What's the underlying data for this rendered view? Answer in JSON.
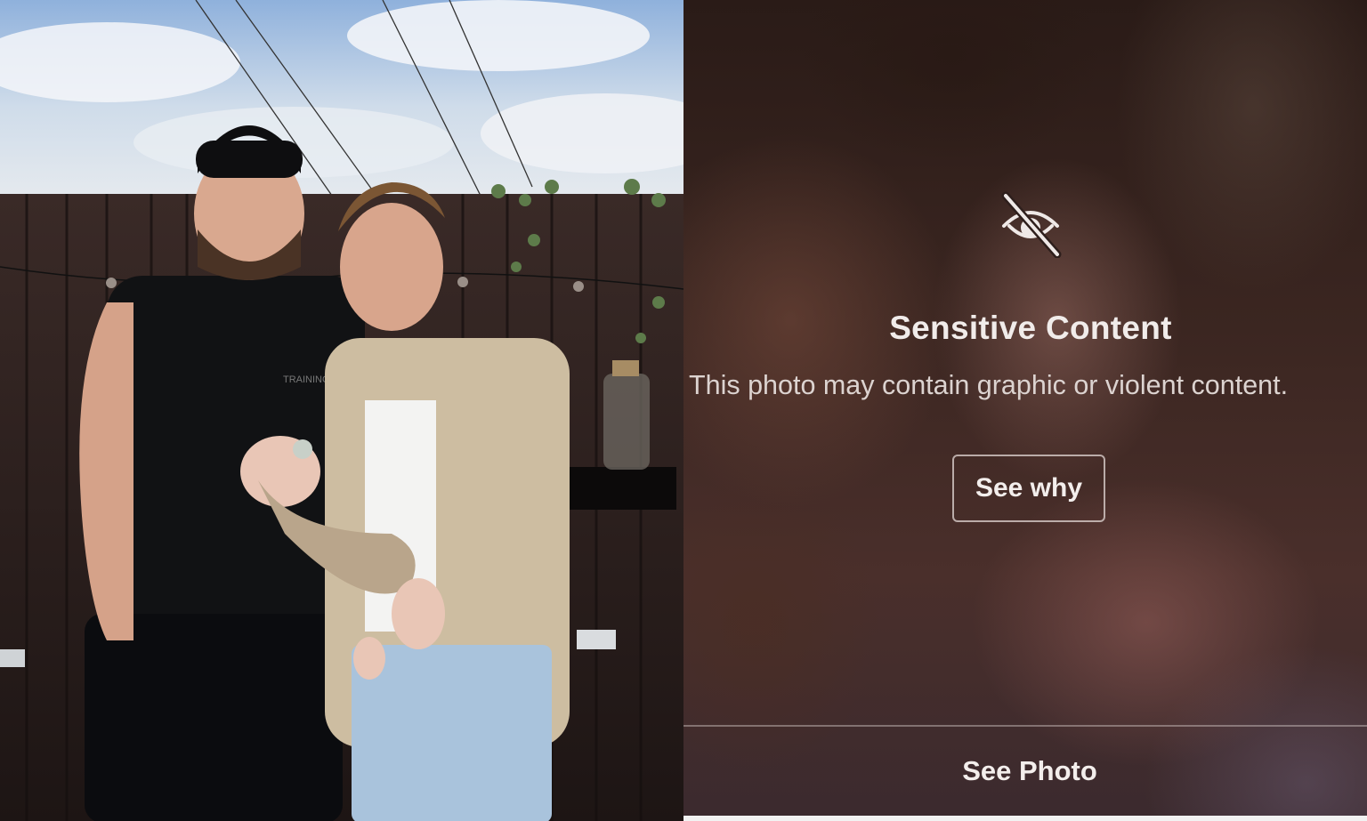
{
  "overlay": {
    "icon": "eye-slash-icon",
    "title": "Sensitive Content",
    "description": "This photo may contain graphic or violent content.",
    "see_why_label": "See why",
    "see_photo_label": "See Photo"
  },
  "photo": {
    "shirt_print": "TRAINING DEPT"
  },
  "colors": {
    "overlay_text": "#f1ecea",
    "overlay_bg": "#3b2621"
  }
}
